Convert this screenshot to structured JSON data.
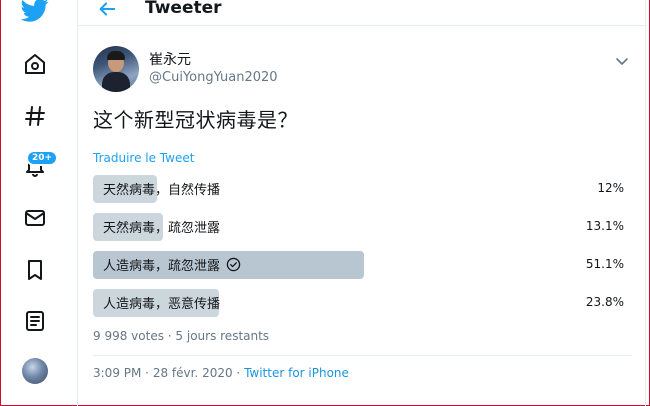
{
  "header": {
    "title": "Tweeter"
  },
  "sidebar": {
    "notification_badge": "20+"
  },
  "tweet": {
    "author_name": "崔永元",
    "author_handle": "@CuiYongYuan2020",
    "text": "这个新型冠状病毒是？",
    "translate_label": "Traduire le Tweet",
    "poll": {
      "options": [
        {
          "label": "天然病毒，自然传播",
          "percent_label": "12%",
          "percent": 12.0,
          "winner": false
        },
        {
          "label": "天然病毒，疏忽泄露",
          "percent_label": "13.1%",
          "percent": 13.1,
          "winner": false
        },
        {
          "label": "人造病毒，疏忽泄露",
          "percent_label": "51.1%",
          "percent": 51.1,
          "winner": true
        },
        {
          "label": "人造病毒，恶意传播",
          "percent_label": "23.8%",
          "percent": 23.8,
          "winner": false
        }
      ],
      "votes": "9 998 votes",
      "remaining": "5 jours restants",
      "separator": " · "
    },
    "time": "3:09 PM",
    "date": "28 févr. 2020",
    "source": "Twitter for iPhone",
    "meta_separator": " · "
  },
  "colors": {
    "accent": "#1da1f2",
    "poll_bar": "#ccd6dd",
    "text_secondary": "#657786"
  },
  "icons": [
    "twitter-bird-icon",
    "home-icon",
    "hashtag-icon",
    "bell-icon",
    "mail-icon",
    "bookmark-icon",
    "list-icon",
    "back-arrow-icon",
    "chevron-down-icon",
    "check-circle-icon"
  ]
}
